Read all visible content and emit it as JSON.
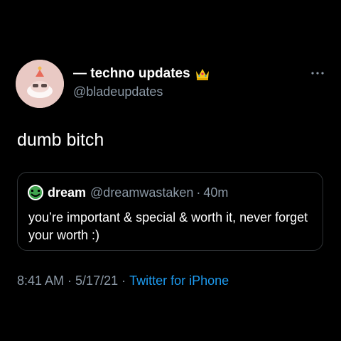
{
  "author": {
    "display_name": "— techno updates",
    "handle": "@bladeupdates",
    "badge_icon": "crown-icon",
    "avatar_color": "#e9c9c4"
  },
  "tweet": {
    "text": "dumb bitch",
    "time": "8:41 AM",
    "date": "5/17/21",
    "separator": "·",
    "source": "Twitter for iPhone"
  },
  "quote": {
    "display_name": "dream",
    "handle": "@dreamwastaken",
    "separator": "·",
    "age": "40m",
    "text": "you’re important & special & worth it, never forget your worth :)",
    "avatar_icon": "dream-smiley-icon"
  },
  "colors": {
    "background": "#000000",
    "primary_text": "#ffffff",
    "secondary_text": "#8b98a5",
    "link": "#1d9bf0",
    "border": "#2f3336"
  }
}
